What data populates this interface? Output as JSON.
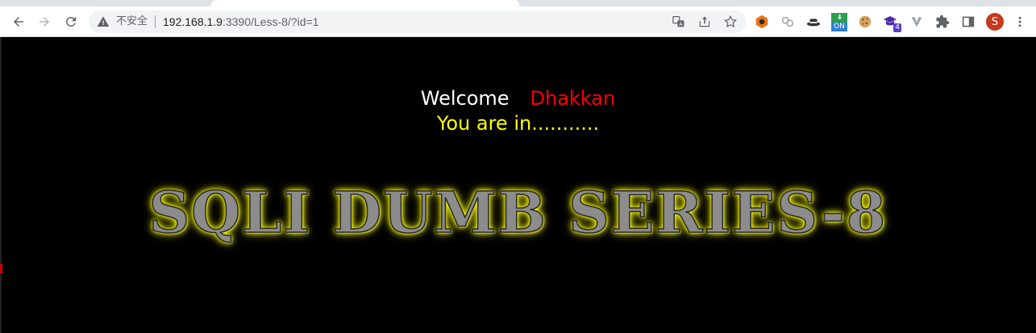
{
  "browser": {
    "not_secure_label": "不安全",
    "url_host": "192.168.1.9",
    "url_path": ":3390/Less-8/?id=1",
    "profile_initial": "S",
    "extension_on_badge": "ON",
    "extension_count_badge": "4"
  },
  "page": {
    "welcome_label": "Welcome",
    "welcome_name": "Dhakkan",
    "status_message": "You are in...........",
    "banner_title": "SQLI DUMB SERIES-8"
  },
  "colors": {
    "background": "#000000",
    "welcome_text": "#ffffff",
    "name_text": "#ff0000",
    "status_text": "#ffff00",
    "banner_glow": "#ffff00"
  }
}
